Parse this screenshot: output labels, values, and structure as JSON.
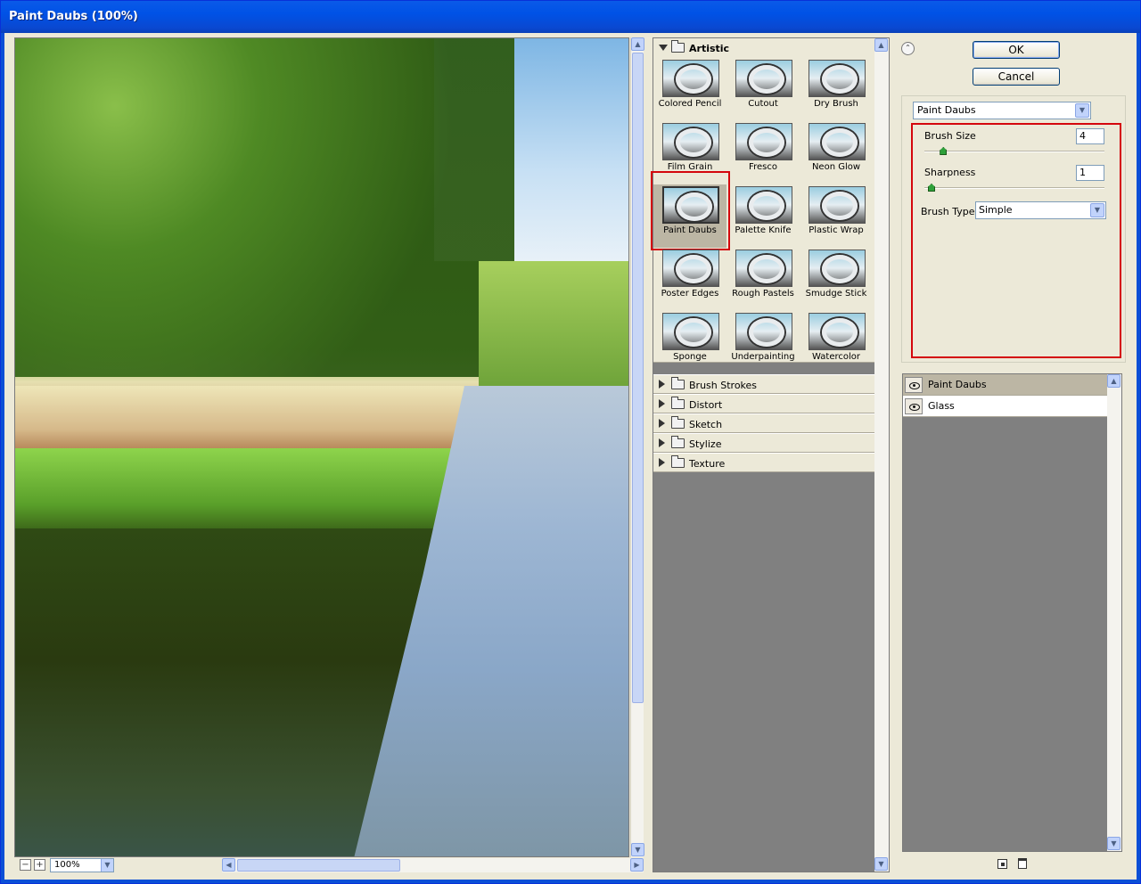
{
  "window": {
    "title": "Paint Daubs (100%)"
  },
  "preview": {
    "zoom": "100%",
    "zoom_out": "−",
    "zoom_in": "+"
  },
  "gallery": {
    "open_folder": "Artistic",
    "filters": [
      {
        "label": "Colored Pencil"
      },
      {
        "label": "Cutout"
      },
      {
        "label": "Dry Brush"
      },
      {
        "label": "Film Grain"
      },
      {
        "label": "Fresco"
      },
      {
        "label": "Neon Glow"
      },
      {
        "label": "Paint Daubs"
      },
      {
        "label": "Palette Knife"
      },
      {
        "label": "Plastic Wrap"
      },
      {
        "label": "Poster Edges"
      },
      {
        "label": "Rough Pastels"
      },
      {
        "label": "Smudge Stick"
      },
      {
        "label": "Sponge"
      },
      {
        "label": "Underpainting"
      },
      {
        "label": "Watercolor"
      }
    ],
    "selected": "Paint Daubs",
    "folders": [
      {
        "label": "Brush Strokes"
      },
      {
        "label": "Distort"
      },
      {
        "label": "Sketch"
      },
      {
        "label": "Stylize"
      },
      {
        "label": "Texture"
      }
    ]
  },
  "buttons": {
    "ok": "OK",
    "cancel": "Cancel"
  },
  "settings": {
    "filter": "Paint Daubs",
    "brush_size_label": "Brush Size",
    "brush_size_value": "4",
    "brush_size_level": 0.07,
    "sharpness_label": "Sharpness",
    "sharpness_value": "1",
    "sharpness_level": 0.0,
    "brush_type_label": "Brush Type:",
    "brush_type_value": "Simple"
  },
  "layers": [
    {
      "name": "Paint Daubs",
      "active": true
    },
    {
      "name": "Glass",
      "active": false
    }
  ],
  "colors": {
    "highlight": "#d4070d",
    "selected_bg": "#bcb6a4"
  }
}
